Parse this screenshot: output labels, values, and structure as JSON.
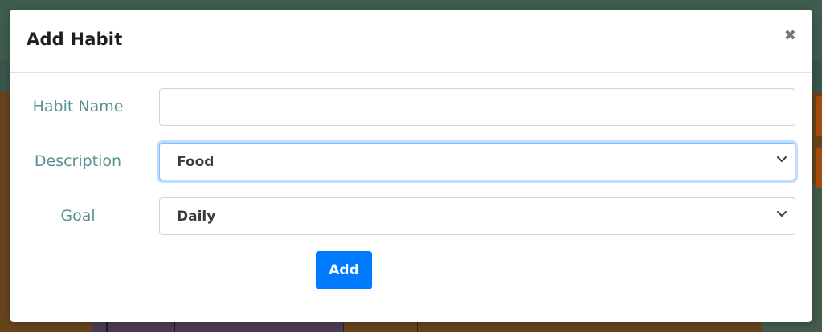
{
  "modal": {
    "title": "Add Habit",
    "close_icon": "close-icon"
  },
  "form": {
    "habit_name": {
      "label": "Habit Name",
      "value": "",
      "placeholder": ""
    },
    "description": {
      "label": "Description",
      "selected": "Food"
    },
    "goal": {
      "label": "Goal",
      "selected": "Daily"
    },
    "submit_label": "Add"
  },
  "colors": {
    "accent": "#007bff",
    "label": "#5a9292",
    "focus": "#80bdff"
  }
}
